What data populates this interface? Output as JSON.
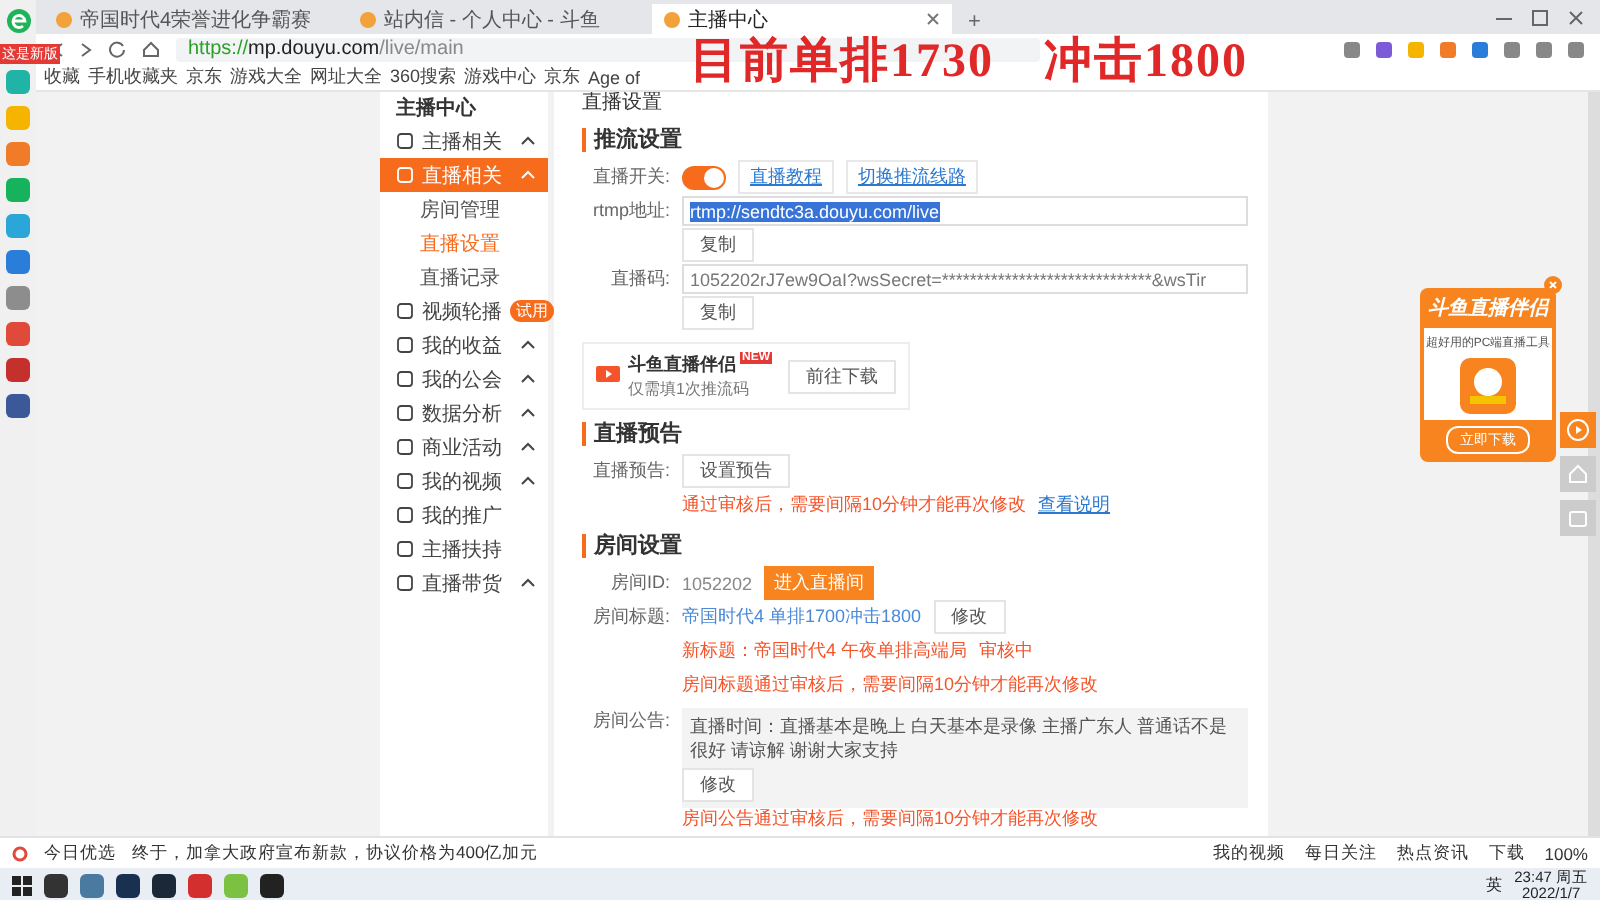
{
  "browser": {
    "badge": "这是新版",
    "tabs": [
      {
        "label": "帝国时代4荣誉进化争霸赛",
        "selected": false
      },
      {
        "label": "站内信 - 个人中心 - 斗鱼",
        "selected": false
      },
      {
        "label": "主播中心",
        "selected": true
      }
    ],
    "new_tab": "+",
    "url_scheme": "https://",
    "url_host": "mp.douyu.com",
    "url_path": "/live/main",
    "bookmarks": [
      "收藏",
      "手机收藏夹",
      "京东",
      "游戏大全",
      "网址大全",
      "360搜索",
      "游戏中心",
      "京东",
      "Age of"
    ]
  },
  "overlay_caption": "目前单排1730　冲击1800",
  "sidebar": {
    "title": "主播中心",
    "items": [
      {
        "label": "主播相关",
        "expandable": true,
        "selected": false
      },
      {
        "label": "直播相关",
        "expandable": true,
        "selected": true,
        "children": [
          {
            "label": "房间管理",
            "selected": false
          },
          {
            "label": "直播设置",
            "selected": true
          },
          {
            "label": "直播记录",
            "selected": false
          }
        ]
      },
      {
        "label": "视频轮播",
        "expandable": false,
        "selected": false,
        "badge": "试用"
      },
      {
        "label": "我的收益",
        "expandable": true,
        "selected": false
      },
      {
        "label": "我的公会",
        "expandable": true,
        "selected": false
      },
      {
        "label": "数据分析",
        "expandable": true,
        "selected": false
      },
      {
        "label": "商业活动",
        "expandable": true,
        "selected": false
      },
      {
        "label": "我的视频",
        "expandable": true,
        "selected": false
      },
      {
        "label": "我的推广",
        "expandable": false,
        "selected": false
      },
      {
        "label": "主播扶持",
        "expandable": false,
        "selected": false
      },
      {
        "label": "直播带货",
        "expandable": true,
        "selected": false
      }
    ]
  },
  "page_title": "直播设置",
  "stream": {
    "title": "推流设置",
    "switch_label": "直播开关:",
    "switch_on": true,
    "links": [
      "直播教程",
      "切换推流线路"
    ],
    "rtmp_label": "rtmp地址:",
    "rtmp_value": "rtmp://sendtc3a.douyu.com/live",
    "copy1": "复制",
    "code_label": "直播码:",
    "code_value": "1052202rJ7ew9OaI?wsSecret=******************************&wsTir",
    "copy2": "复制",
    "promo_title": "斗鱼直播伴侣",
    "promo_badge": "NEW",
    "promo_sub": "仅需填1次推流码",
    "promo_button": "前往下载"
  },
  "preview": {
    "title": "直播预告",
    "label": "直播预告:",
    "button": "设置预告",
    "note": "通过审核后，需要间隔10分钟才能再次修改",
    "link": "查看说明"
  },
  "room": {
    "title": "房间设置",
    "id_label": "房间ID:",
    "id_value": "1052202",
    "enter_button": "进入直播间",
    "title_label": "房间标题:",
    "title_value": "帝国时代4 单排1700冲击1800",
    "edit1": "修改",
    "new_title": "新标题：帝国时代4 午夜单排高端局",
    "review": "审核中",
    "title_note": "房间标题通过审核后，需要间隔10分钟才能再次修改",
    "notice_label": "房间公告:",
    "notice_value": "直播时间：直播基本是晚上 白天基本是录像 主播广东人 普通话不是很好 请谅解 谢谢大家支持",
    "edit2": "修改",
    "notice_note": "房间公告通过审核后，需要间隔10分钟才能再次修改"
  },
  "ad": {
    "title": "斗鱼直播伴侣",
    "sub": "超好用的PC端直播工具",
    "button": "立即下载"
  },
  "status_bar": {
    "left": "今日优选",
    "headline": "终于，加拿大政府宣布新款，协议价格为400亿加元",
    "right": [
      "我的视频",
      "每日关注",
      "热点资讯"
    ],
    "download": "下载",
    "zoom": "100%"
  },
  "taskbar": {
    "ime": "英",
    "time": "23:47 周五",
    "date": "2022/1/7"
  }
}
